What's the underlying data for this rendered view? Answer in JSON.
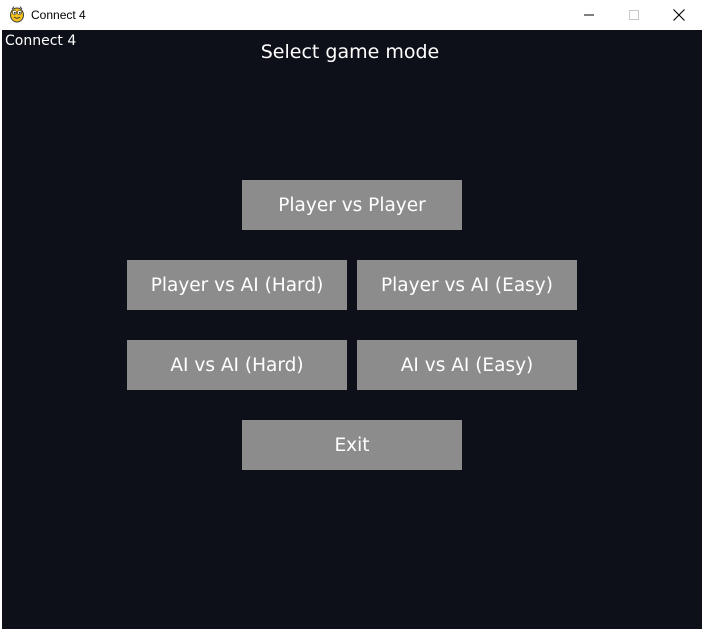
{
  "window": {
    "title": "Connect 4",
    "app_icon": "pygame-snake-icon",
    "controls": {
      "minimize_icon": "minimize-icon",
      "maximize_icon": "maximize-icon",
      "close_icon": "close-icon"
    }
  },
  "game": {
    "corner_label": "Connect 4",
    "heading": "Select game mode",
    "buttons": {
      "player_vs_player": "Player vs Player",
      "player_vs_ai_hard": "Player vs AI (Hard)",
      "player_vs_ai_easy": "Player vs AI (Easy)",
      "ai_vs_ai_hard": "AI vs AI (Hard)",
      "ai_vs_ai_easy": "AI vs AI (Easy)",
      "exit": "Exit"
    }
  },
  "colors": {
    "background": "#0d1018",
    "button": "#8c8c8c",
    "text": "#ffffff"
  }
}
